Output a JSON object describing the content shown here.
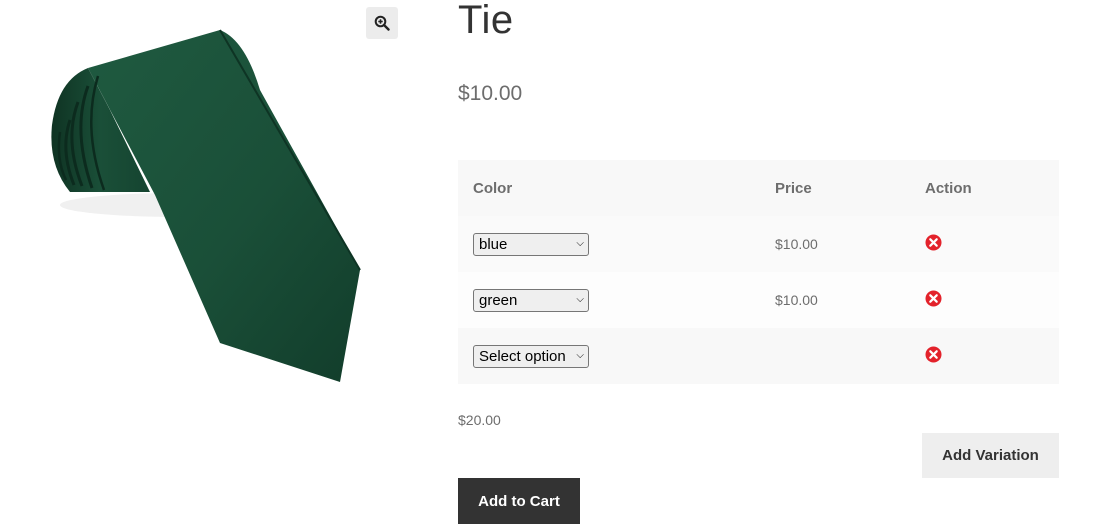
{
  "product": {
    "title": "Tie",
    "price": "$10.00",
    "image_icon": "green-tie-image",
    "zoom_icon": "magnify-plus-icon",
    "accent_color": "#1c4a36"
  },
  "variations": {
    "headers": {
      "color": "Color",
      "price": "Price",
      "action": "Action"
    },
    "rows": [
      {
        "color": "blue",
        "price": "$10.00",
        "action_icon": "remove-icon"
      },
      {
        "color": "green",
        "price": "$10.00",
        "action_icon": "remove-icon"
      },
      {
        "color": "Select option",
        "price": "",
        "action_icon": "remove-icon"
      }
    ],
    "remove_color": "#e3222b"
  },
  "total": "$20.00",
  "buttons": {
    "add_variation": "Add Variation",
    "add_to_cart": "Add to Cart"
  }
}
